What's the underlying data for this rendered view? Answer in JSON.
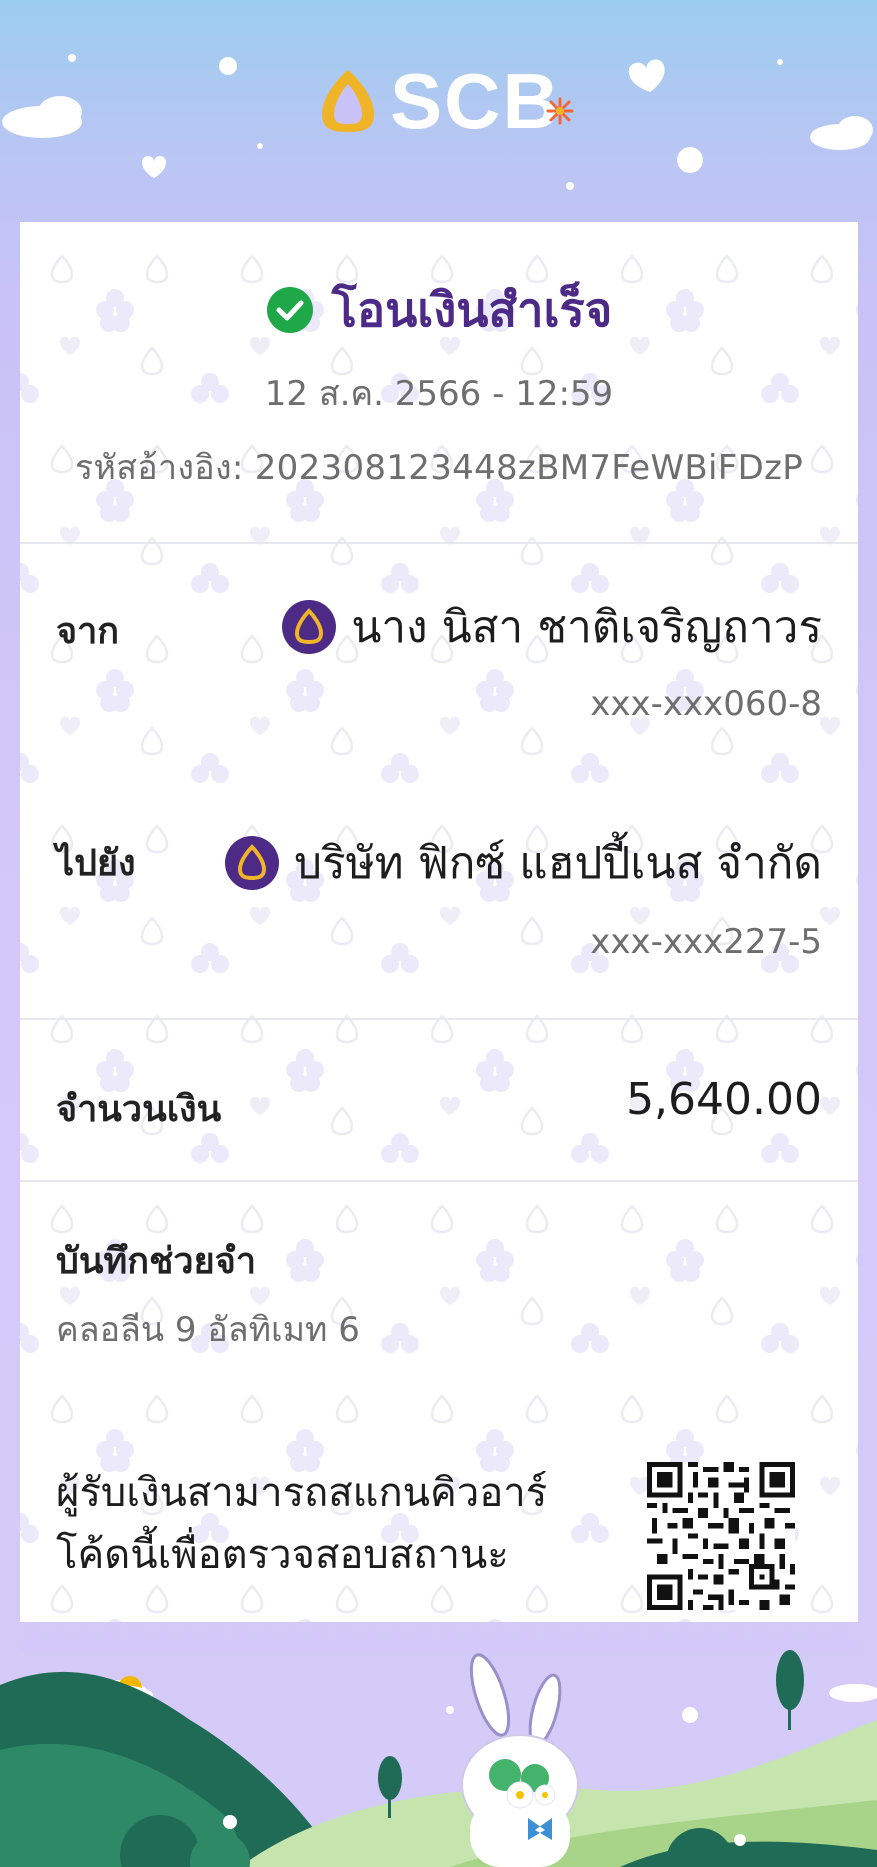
{
  "app": {
    "brand": "SCB"
  },
  "receipt": {
    "status": "โอนเงินสำเร็จ",
    "datetime": "12 ส.ค. 2566 - 12:59",
    "reference": "รหัสอ้างอิง: 202308123448zBM7FeWBiFDzP",
    "from": {
      "label": "จาก",
      "name": "นาง นิสา ชาติเจริญถาวร",
      "account": "xxx-xxx060-8"
    },
    "to": {
      "label": "ไปยัง",
      "name": "บริษัท ฟิกซ์ แฮปปี้เนส จำกัด",
      "account": "xxx-xxx227-5"
    },
    "amount": {
      "label": "จำนวนเงิน",
      "value": "5,640.00"
    },
    "memo": {
      "label": "บันทึกช่วยจำ",
      "text": "คลอลีน 9 อัลทิเมท 6"
    },
    "qr_note": "ผู้รับเงินสามารถสแกนคิวอาร์โค้ดนี้เพื่อตรวจสอบสถานะ"
  },
  "colors": {
    "brand_purple": "#4d2a86",
    "success_green": "#1ea848",
    "gold": "#f0b429"
  }
}
